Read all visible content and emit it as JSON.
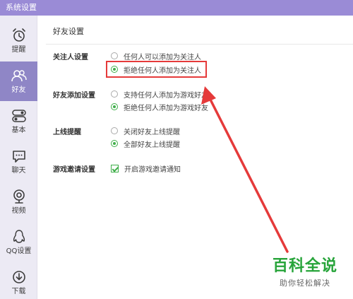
{
  "window": {
    "title": "系统设置"
  },
  "sidebar": {
    "items": [
      {
        "label": "提醒",
        "icon": "alarm-clock-icon",
        "active": false
      },
      {
        "label": "好友",
        "icon": "friends-icon",
        "active": true
      },
      {
        "label": "基本",
        "icon": "toggle-switch-icon",
        "active": false
      },
      {
        "label": "聊天",
        "icon": "chat-bubble-icon",
        "active": false
      },
      {
        "label": "视频",
        "icon": "webcam-icon",
        "active": false
      },
      {
        "label": "QQ设置",
        "icon": "qq-penguin-icon",
        "active": false
      },
      {
        "label": "下载",
        "icon": "download-icon",
        "active": false
      }
    ]
  },
  "main": {
    "section_title": "好友设置",
    "groups": [
      {
        "label": "关注人设置",
        "options": [
          {
            "text": "任何人可以添加为关注人",
            "checked": false
          },
          {
            "text": "拒绝任何人添加为关注人",
            "checked": true
          }
        ]
      },
      {
        "label": "好友添加设置",
        "options": [
          {
            "text": "支持任何人添加为游戏好友",
            "checked": false
          },
          {
            "text": "拒绝任何人添加为游戏好友",
            "checked": true
          }
        ]
      },
      {
        "label": "上线提醒",
        "options": [
          {
            "text": "关闭好友上线提醒",
            "checked": false
          },
          {
            "text": "全部好友上线提醒",
            "checked": true
          }
        ]
      },
      {
        "label": "游戏邀请设置",
        "options": [
          {
            "text": "开启游戏邀请通知",
            "checked": true,
            "type": "checkbox"
          }
        ]
      }
    ]
  },
  "colors": {
    "titlebar": "#9a8bd6",
    "sidebar_active": "#8f86c6",
    "accent_green": "#3fae49",
    "annotation_red": "#e53a3a",
    "watermark_green": "#27a43a"
  },
  "watermark": {
    "main": "百科全说",
    "sub": "助你轻松解决"
  }
}
